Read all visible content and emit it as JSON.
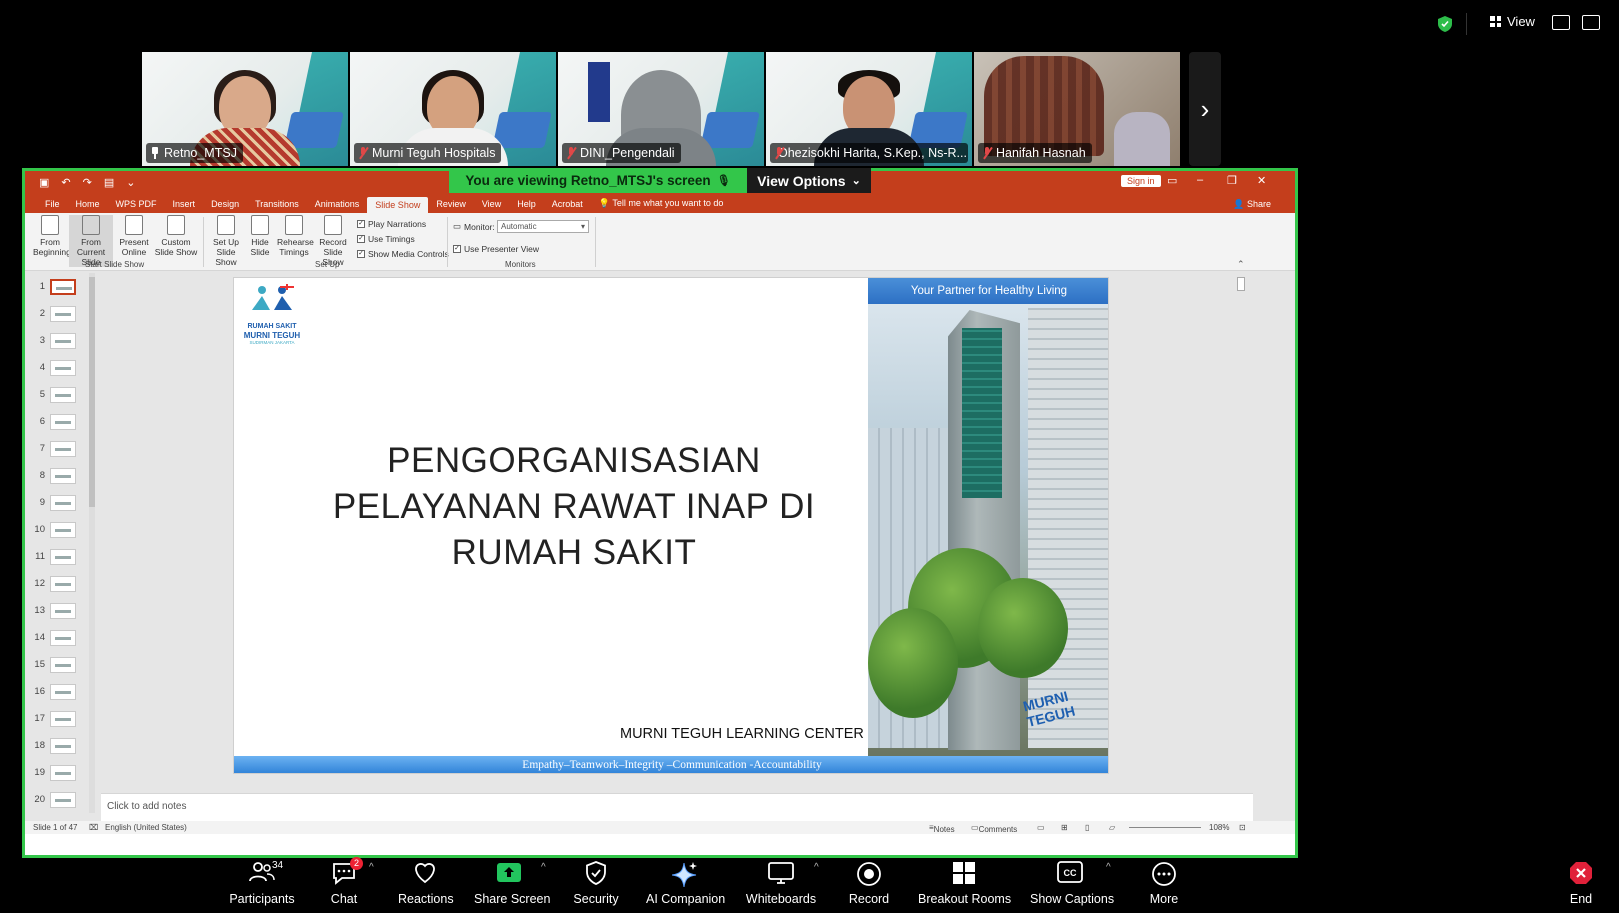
{
  "topbar": {
    "view_label": "View"
  },
  "participants": [
    {
      "name": "Retno_MTSJ",
      "muted": false,
      "pinned": true
    },
    {
      "name": "Murni Teguh Hospitals",
      "muted": true
    },
    {
      "name": "DINI_Pengendali",
      "muted": true
    },
    {
      "name": "Ohezisokhi Harita, S.Kep., Ns-R...",
      "muted": true
    },
    {
      "name": "Hanifah Hasnah",
      "muted": true
    }
  ],
  "share_banner": {
    "viewing": "You are viewing  Retno_MTSJ's screen",
    "view_options": "View Options"
  },
  "ppt": {
    "sign_in": "Sign in",
    "share": "Share",
    "tabs": [
      "File",
      "Home",
      "WPS PDF",
      "Insert",
      "Design",
      "Transitions",
      "Animations",
      "Slide Show",
      "Review",
      "View",
      "Help",
      "Acrobat"
    ],
    "tell_me": "Tell me what you want to do",
    "ribbon": {
      "from_beginning": "From Beginning",
      "from_current": "From Current Slide",
      "present_online": "Present Online",
      "custom_show": "Custom Slide Show",
      "group1": "Start Slide Show",
      "set_up": "Set Up Slide Show",
      "hide_slide": "Hide Slide",
      "rehearse": "Rehearse Timings",
      "record": "Record Slide Show",
      "play_narrations": "Play Narrations",
      "use_timings": "Use Timings",
      "show_media": "Show Media Controls",
      "group2": "Set Up",
      "monitor_label": "Monitor:",
      "monitor_value": "Automatic",
      "presenter_view": "Use Presenter View",
      "group3": "Monitors"
    },
    "slide_numbers": [
      "1",
      "2",
      "3",
      "4",
      "5",
      "6",
      "7",
      "8",
      "9",
      "10",
      "11",
      "12",
      "13",
      "14",
      "15",
      "16",
      "17",
      "18",
      "19",
      "20"
    ],
    "slide": {
      "logo_line1": "RUMAH SAKIT",
      "logo_line2": "MURNI TEGUH",
      "logo_line3": "SUDIRMAN JAKARTA",
      "title_line1": "PENGORGANISASIAN",
      "title_line2": "PELAYANAN RAWAT INAP DI",
      "title_line3": "RUMAH SAKIT",
      "center": "MURNI TEGUH LEARNING CENTER",
      "side_header": "Your Partner for Healthy Living",
      "side_sign": "MURNI TEGUH",
      "footer": "Empathy–Teamwork–Integrity –Communication -Accountability"
    },
    "notes_placeholder": "Click to add notes",
    "status": {
      "slide": "Slide 1 of 47",
      "language": "English (United States)",
      "notes": "Notes",
      "comments": "Comments",
      "zoom": "108%"
    }
  },
  "bottombar": {
    "participants": "Participants",
    "participants_count": "34",
    "chat": "Chat",
    "chat_badge": "2",
    "reactions": "Reactions",
    "share_screen": "Share Screen",
    "security": "Security",
    "ai_companion": "AI Companion",
    "whiteboards": "Whiteboards",
    "record": "Record",
    "breakout": "Breakout Rooms",
    "captions": "Show Captions",
    "more": "More",
    "end": "End"
  },
  "colors": {
    "zoom_green": "#33c64a",
    "ppt_red": "#c43e1c",
    "end_red": "#e0213a"
  }
}
